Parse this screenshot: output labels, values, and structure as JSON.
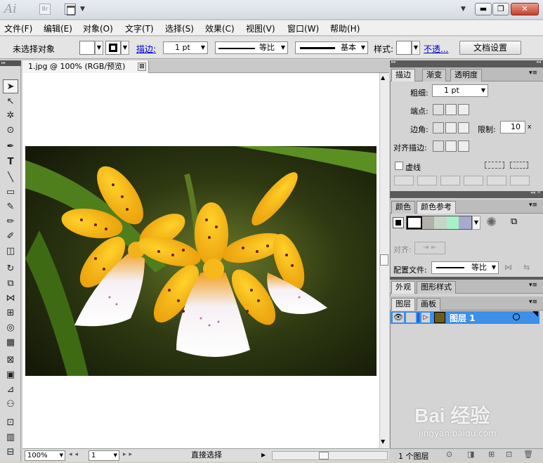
{
  "app": {
    "logo_text": "Ai",
    "bridge_text": "Br"
  },
  "menu": [
    "文件(F)",
    "编辑(E)",
    "对象(O)",
    "文字(T)",
    "选择(S)",
    "效果(C)",
    "视图(V)",
    "窗口(W)",
    "帮助(H)"
  ],
  "control_bar": {
    "selection_status": "未选择对象",
    "stroke_link": "描边:",
    "stroke_weight": "1 pt",
    "stroke_profile": "等比",
    "brush_label": "基本",
    "style_label": "样式:",
    "opacity_link": "不透...",
    "doc_setup_button": "文档设置"
  },
  "document": {
    "tab_title": "1.jpg @ 100% (RGB/预览)",
    "tab_close": "⊠"
  },
  "status_bar": {
    "zoom": "100%",
    "artboard": "1",
    "current_tool": "直接选择"
  },
  "stroke_panel": {
    "tabs": [
      "描边",
      "渐变",
      "透明度"
    ],
    "weight_label": "粗细:",
    "weight_value": "1 pt",
    "cap_label": "端点:",
    "corner_label": "边角:",
    "limit_label": "限制:",
    "limit_value": "10",
    "limit_unit": "x",
    "align_label": "对齐描边:",
    "dashed_label": "虚线"
  },
  "color_panel": {
    "tabs": [
      "颜色",
      "颜色参考"
    ],
    "align_label": "对齐:",
    "profile_label": "配置文件:",
    "profile_value": "等比"
  },
  "appearance_tabs": [
    "外观",
    "图形样式"
  ],
  "layers_panel": {
    "tabs": [
      "图层",
      "画板"
    ],
    "layer_name": "图层 1",
    "footer": "1 个图层"
  },
  "watermark": {
    "brand": "Bai 经验",
    "url": "jingyan.baidu.com"
  },
  "colors": {
    "layer_highlight": "#3d8fe8",
    "link_blue": "#0000cc"
  }
}
